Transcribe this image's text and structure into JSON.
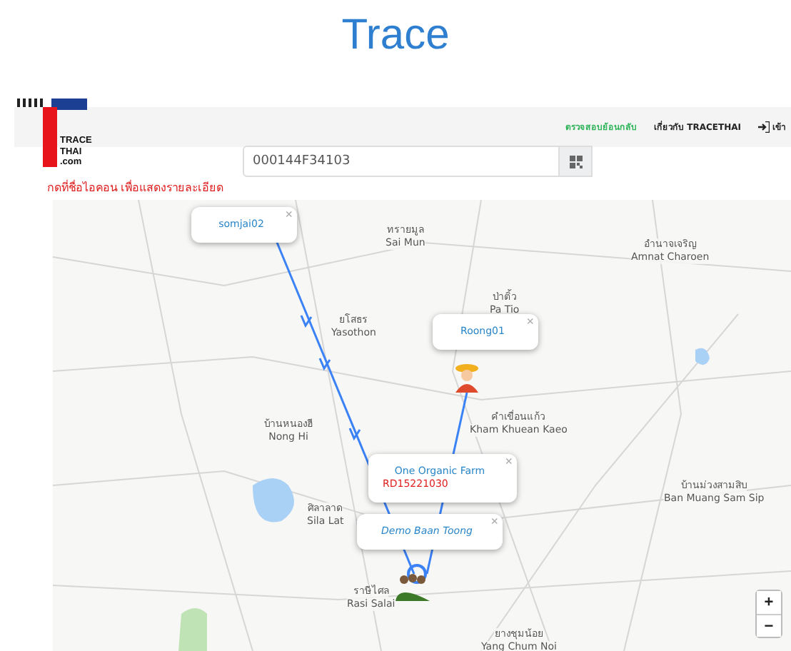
{
  "page_title": "Trace",
  "nav": {
    "links": [
      {
        "label": "ตรวจสอบย้อนกลับ",
        "selected": true
      },
      {
        "label": "เกี่ยวกับ TRACETHAI",
        "selected": false
      }
    ],
    "login": "เข้า"
  },
  "logo": {
    "lines": [
      "TRACE",
      "THAI",
      ".com"
    ]
  },
  "search": {
    "value": "000144F34103"
  },
  "hint": "กดที่ชื่อไอคอน เพื่อแสดงรายละเอียด",
  "map": {
    "places": [
      {
        "thai": "ทรายมูล",
        "name": "Sai Mun"
      },
      {
        "thai": "ป่าติ้ว",
        "name": "Pa Tio"
      },
      {
        "thai": "อำนาจเจริญ",
        "name": "Amnat Charoen"
      },
      {
        "thai": "ยโสธร",
        "name": "Yasothon"
      },
      {
        "thai": "คำเขื่อนแก้ว",
        "name": "Kham Khuean Kaeo"
      },
      {
        "thai": "บ้านหนองฮี",
        "name": "Nong Hi"
      },
      {
        "thai": "ศิลาลาด",
        "name": "Sila Lat"
      },
      {
        "thai": "บ้านม่วงสามสิบ",
        "name": "Ban Muang Sam Sip"
      },
      {
        "thai": "ราษีไศล",
        "name": "Rasi Salai"
      },
      {
        "thai": "ยางชุมน้อย",
        "name": "Yang Chum Noi"
      }
    ],
    "popups": [
      {
        "close": "×",
        "lines": [
          {
            "kind": "name",
            "text": "somjai02"
          }
        ]
      },
      {
        "close": "×",
        "lines": [
          {
            "kind": "name",
            "text": "Roong01"
          }
        ]
      },
      {
        "close": "×",
        "lines": [
          {
            "kind": "name",
            "text": "One Organic Farm"
          },
          {
            "kind": "code",
            "text": "RD15221030"
          }
        ]
      },
      {
        "close": "×",
        "lines": [
          {
            "kind": "place",
            "text": "Demo Baan Toong"
          }
        ]
      }
    ],
    "zoom_in": "+",
    "zoom_out": "−"
  }
}
